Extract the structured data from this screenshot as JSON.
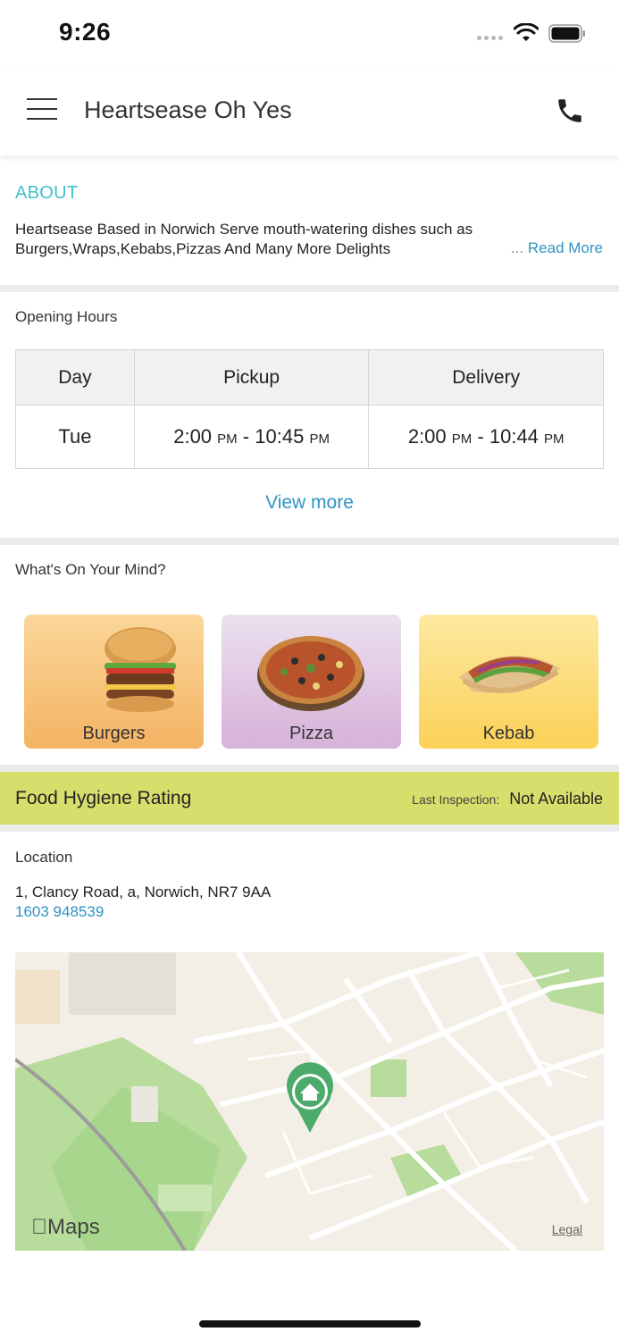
{
  "status_bar": {
    "time": "9:26"
  },
  "header": {
    "title": "Heartsease Oh Yes"
  },
  "about": {
    "heading": "ABOUT",
    "text": "Heartsease Based in Norwich Serve mouth-watering dishes such as Burgers,Wraps,Kebabs,Pizzas And Many More Delights",
    "ellipsis": "...",
    "read_more": "Read More"
  },
  "opening_hours": {
    "heading": "Opening Hours",
    "columns": [
      "Day",
      "Pickup",
      "Delivery"
    ],
    "rows": [
      {
        "day": "Tue",
        "pickup": {
          "start": "2:00",
          "start_ampm": "PM",
          "sep": "-",
          "end": "10:45",
          "end_ampm": "PM"
        },
        "delivery": {
          "start": "2:00",
          "start_ampm": "PM",
          "sep": "-",
          "end": "10:44",
          "end_ampm": "PM"
        }
      }
    ],
    "view_more": "View more"
  },
  "categories": {
    "heading": "What's On Your Mind?",
    "items": [
      {
        "label": "Burgers",
        "icon": "burger-icon"
      },
      {
        "label": "Pizza",
        "icon": "pizza-icon"
      },
      {
        "label": "Kebab",
        "icon": "kebab-icon"
      }
    ]
  },
  "hygiene": {
    "title": "Food Hygiene Rating",
    "inspection_label": "Last Inspection:",
    "inspection_value": "Not Available"
  },
  "location": {
    "heading": "Location",
    "address": "1, Clancy Road, a, Norwich, NR7 9AA",
    "phone": "1603 948539",
    "map_brand": "Maps",
    "map_legal": "Legal"
  },
  "colors": {
    "accent_teal": "#3ec1c9",
    "link_blue": "#2f93c4",
    "hygiene_bar": "#d7de6c",
    "map_pin": "#4caa6b"
  }
}
